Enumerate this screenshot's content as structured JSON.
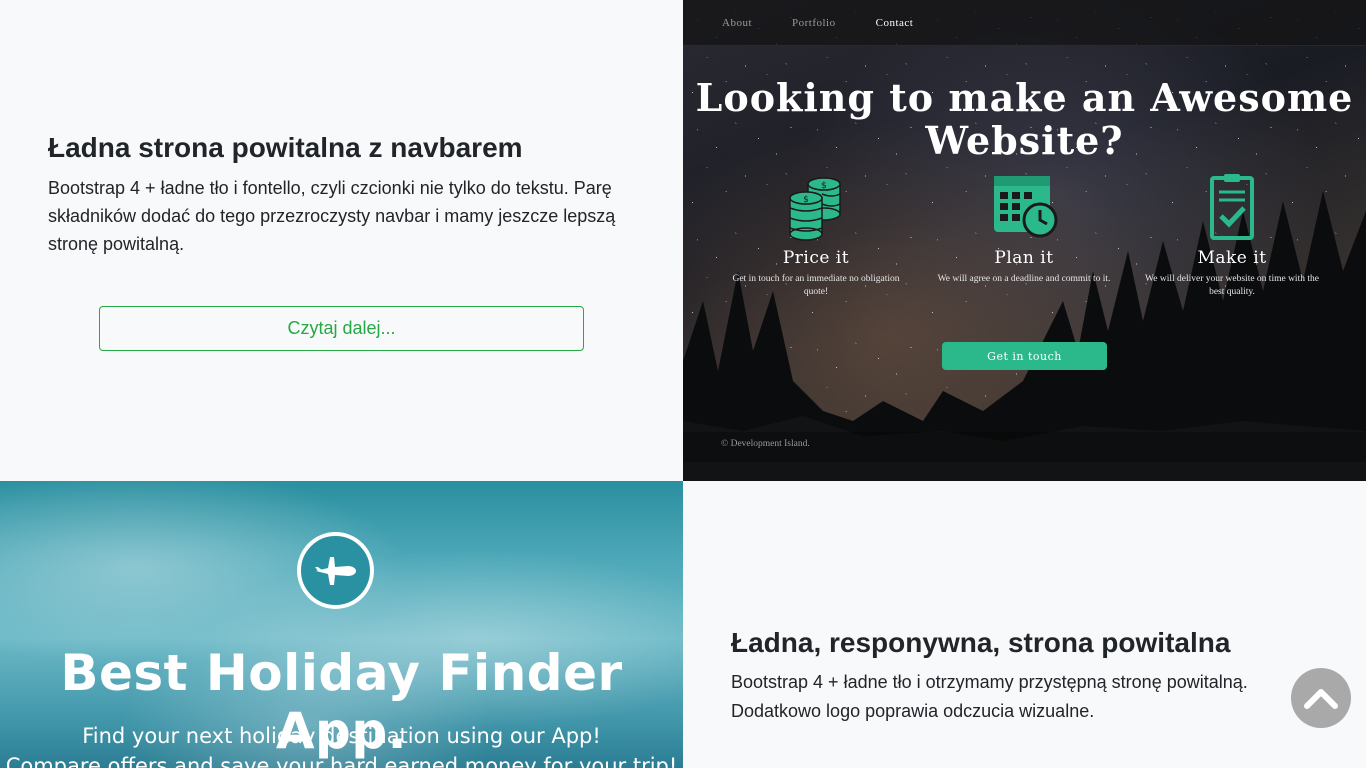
{
  "card_top_left": {
    "heading": "Ładna strona powitalna z navbarem",
    "description": "Bootstrap 4 + ładne tło i fontello, czyli czcionki nie tylko do tekstu. Parę składników dodać do tego przezroczysty navbar i mamy jeszcze lepszą stronę powitalną.",
    "button_label": "Czytaj dalej...",
    "button_color": "#28a745"
  },
  "preview_night": {
    "nav": [
      "About",
      "Portfolio",
      "Contact"
    ],
    "active_nav": "Contact",
    "title": "Looking to make an Awesome Website?",
    "features": [
      {
        "icon": "coins-icon",
        "title": "Price it",
        "text": "Get in touch for an immediate no obligation quote!"
      },
      {
        "icon": "calendar-clock-icon",
        "title": "Plan it",
        "text": "We will agree on a deadline and commit to it."
      },
      {
        "icon": "clipboard-check-icon",
        "title": "Make it",
        "text": "We will deliver your website on time with the best quality."
      }
    ],
    "cta": "Get in touch",
    "accent": "#2bb98b",
    "footer": "© Development Island."
  },
  "preview_sky": {
    "icon": "airplane-icon",
    "title": "Best Holiday Finder App.",
    "subtitle_1": "Find your next holiday destination using our App!",
    "subtitle_2": "Compare offers and save your hard earned money for your trip!"
  },
  "card_bottom_right": {
    "heading": "Ładna, responywna, strona powitalna",
    "description": "Bootstrap 4 + ładne tło i otrzymamy przystępną stronę powitalną. Dodatkowo logo poprawia odczucia wizualne."
  },
  "scroll_top": {
    "icon": "chevron-up-icon",
    "color": "#a9a9a9"
  }
}
